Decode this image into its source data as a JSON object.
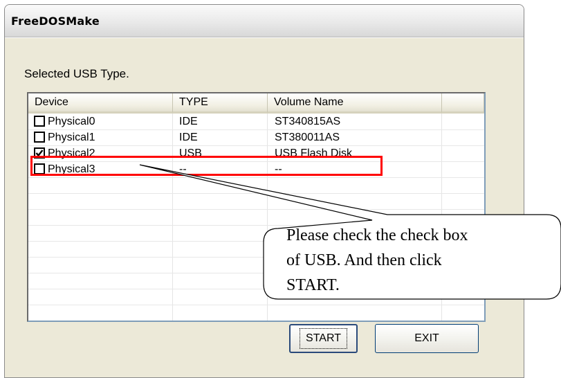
{
  "window": {
    "title": "FreeDOSMake"
  },
  "section_label": "Selected USB Type.",
  "table": {
    "columns": [
      "Device",
      "TYPE",
      "Volume Name",
      ""
    ],
    "rows": [
      {
        "device": "Physical0",
        "type": "IDE",
        "volume": "ST340815AS",
        "checked": false
      },
      {
        "device": "Physical1",
        "type": "IDE",
        "volume": "ST380011AS",
        "checked": false
      },
      {
        "device": "Physical2",
        "type": "USB",
        "volume": "USB Flash Disk",
        "checked": true
      },
      {
        "device": "Physical3",
        "type": "--",
        "volume": "--",
        "checked": false
      }
    ]
  },
  "buttons": {
    "start": "START",
    "exit": "EXIT"
  },
  "callout": {
    "lines": [
      "Please check the check box",
      "of USB. And then click",
      "START."
    ]
  },
  "colors": {
    "highlight": "#ff0000",
    "window_bg": "#ece9d8",
    "list_border": "#7f9db9"
  }
}
